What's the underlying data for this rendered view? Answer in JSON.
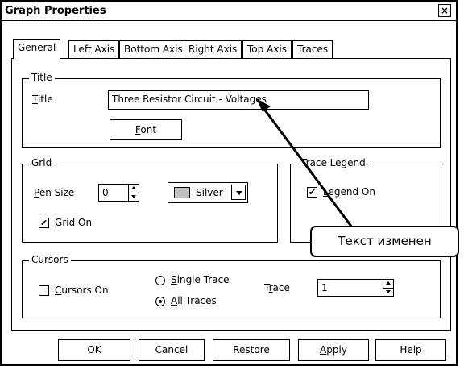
{
  "dialog": {
    "title": "Graph Properties",
    "close_label": "×"
  },
  "tabs": [
    {
      "label": "General",
      "active": true
    },
    {
      "label": "Left Axis"
    },
    {
      "label": "Bottom Axis"
    },
    {
      "label": "Right Axis"
    },
    {
      "label": "Top Axis"
    },
    {
      "label": "Traces"
    }
  ],
  "title_group": {
    "legend": "Title",
    "label_accel": "T",
    "label_rest": "itle",
    "value": "Three Resistor Circuit - Voltages",
    "font_button_accel": "F",
    "font_button_rest": "ont"
  },
  "grid_group": {
    "legend": "Grid",
    "pen_size_accel": "P",
    "pen_size_rest": "en Size",
    "pen_size_value": "0",
    "color_value": "Silver",
    "color_swatch": "#c0c0c0",
    "grid_on_accel": "G",
    "grid_on_rest": "rid On",
    "grid_on_checked": "✔"
  },
  "trace_legend_group": {
    "legend": "Trace Legend",
    "legend_on_accel": "L",
    "legend_on_rest": "egend On",
    "legend_on_checked": "✔"
  },
  "cursors_group": {
    "legend": "Cursors",
    "cursors_on_accel": "C",
    "cursors_on_rest": "ursors On",
    "single_trace_accel": "S",
    "single_trace_rest": "ingle Trace",
    "all_traces_accel": "A",
    "all_traces_rest": "ll Traces",
    "trace_label_pre": "T",
    "trace_label_accel": "r",
    "trace_label_rest": "ace",
    "trace_value": "1"
  },
  "buttons": {
    "ok": "OK",
    "cancel": "Cancel",
    "restore": "Restore",
    "apply_accel": "A",
    "apply_rest": "pply",
    "help": "Help"
  },
  "annotation": {
    "callout_text": "Текст изменен"
  }
}
